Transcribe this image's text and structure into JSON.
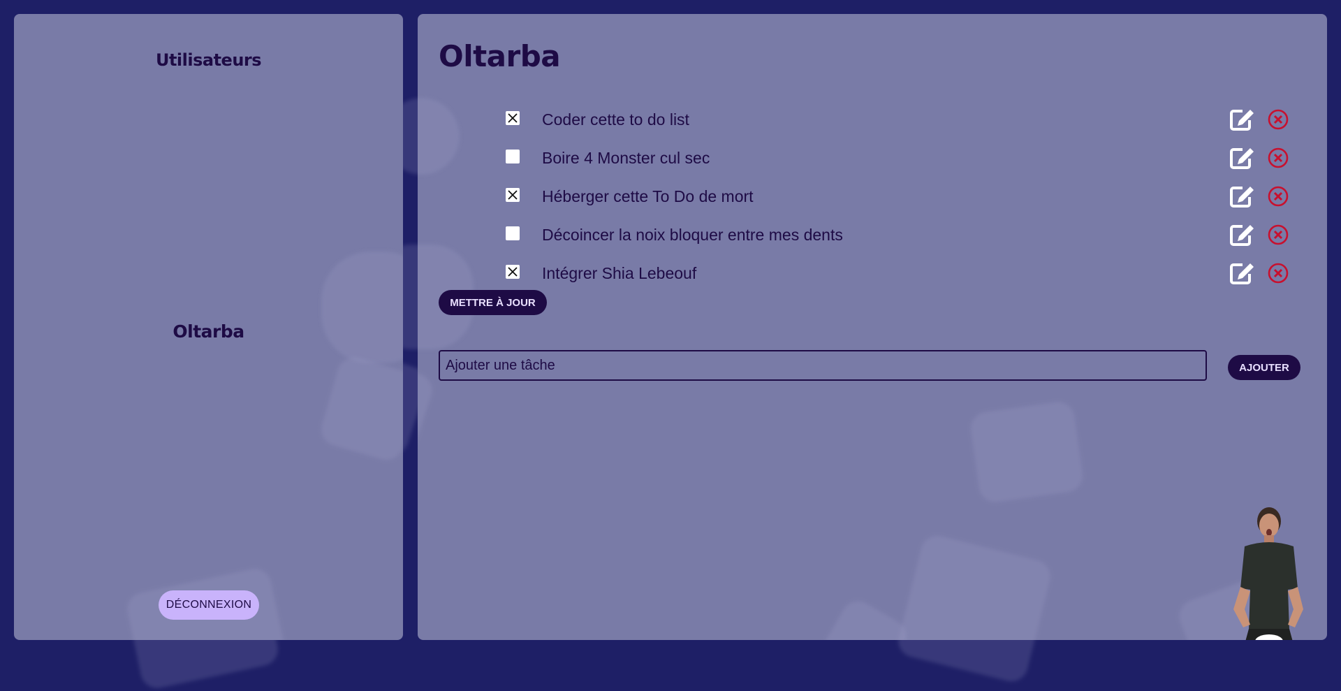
{
  "sidebar": {
    "title": "Utilisateurs",
    "users": [
      {
        "name": "Oltarba"
      }
    ],
    "logout_label": "DÉCONNEXION"
  },
  "main": {
    "title": "Oltarba",
    "todos": [
      {
        "text": "Coder cette to do list",
        "checked": true
      },
      {
        "text": "Boire 4 Monster cul sec",
        "checked": false
      },
      {
        "text": "Héberger cette To Do de mort",
        "checked": true
      },
      {
        "text": "Décoincer la noix bloquer entre mes dents",
        "checked": false
      },
      {
        "text": "Intégrer Shia Lebeouf",
        "checked": true
      }
    ],
    "update_label": "METTRE À JOUR",
    "new_task_placeholder": "Ajouter une tâche",
    "add_label": "AJOUTER"
  },
  "icons": {
    "edit": "edit-icon",
    "delete": "delete-icon",
    "check": "check-x-icon"
  },
  "colors": {
    "page_bg": "#1e1f66",
    "panel_bg": "#797ba7",
    "text_dark": "#1e0b45",
    "button_dark": "#1e0b45",
    "button_light": "#c9b3fb",
    "delete_red": "#c8102e"
  }
}
